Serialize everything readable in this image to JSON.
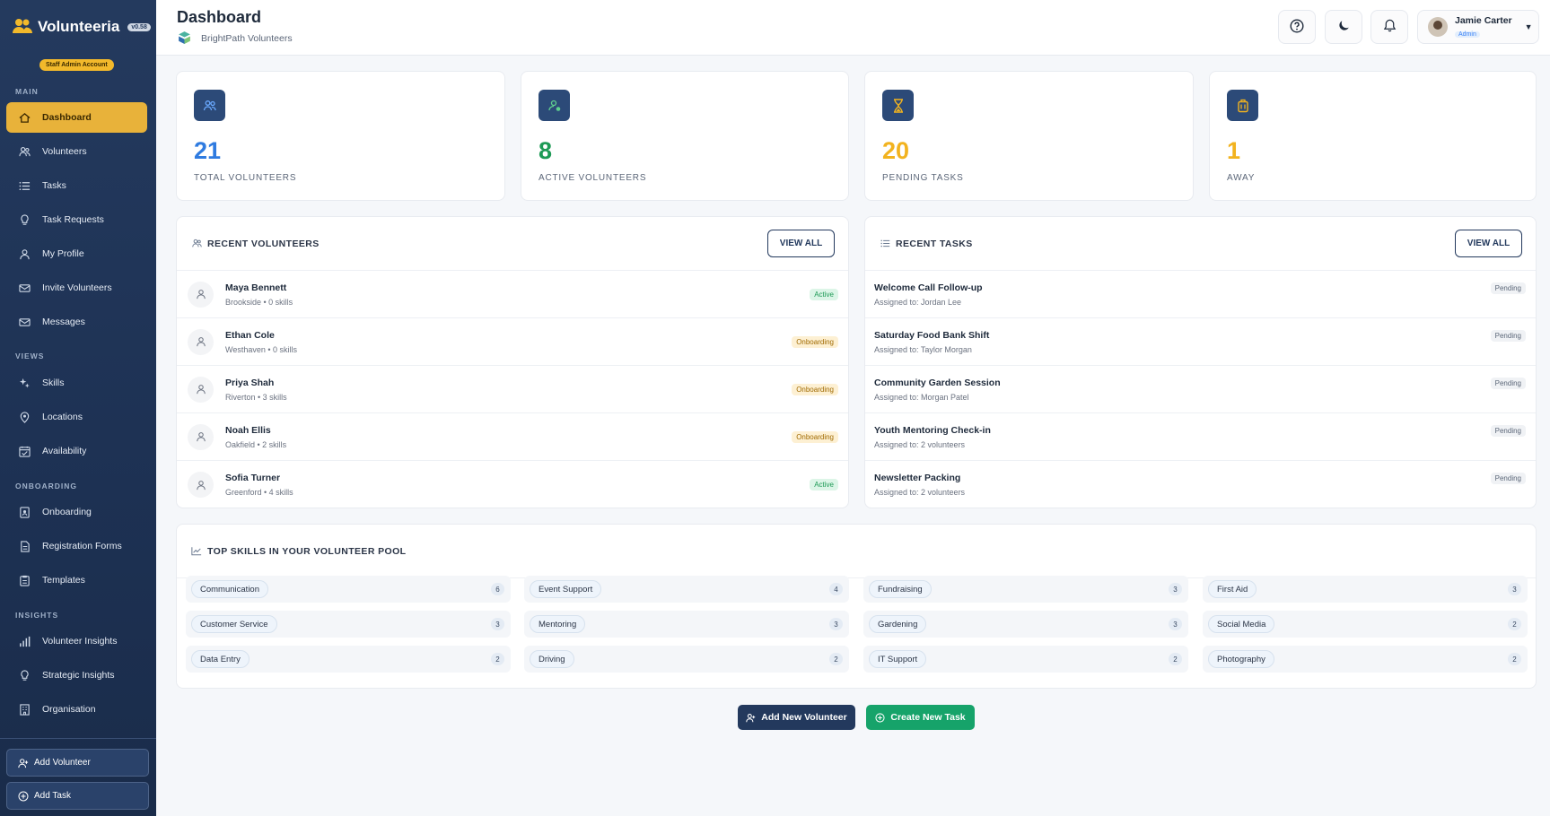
{
  "app": {
    "name": "Volunteeria",
    "version": "v0.58",
    "staff_badge": "Staff Admin Account"
  },
  "colors": {
    "sidebar_bg": "#1d3153",
    "active_nav": "#e8b23a",
    "blue_stat": "#2f7be0",
    "green_stat": "#1d9a55",
    "yellow_stat": "#f2b31f",
    "primary_button": "#23395d",
    "create_button": "#16a36a"
  },
  "sidebar": {
    "sections": [
      {
        "label": "MAIN"
      },
      {
        "label": "VIEWS"
      },
      {
        "label": "ONBOARDING"
      },
      {
        "label": "INSIGHTS"
      }
    ],
    "items": [
      {
        "label": "Dashboard",
        "icon": "home-icon",
        "active": true
      },
      {
        "label": "Volunteers",
        "icon": "users-icon"
      },
      {
        "label": "Tasks",
        "icon": "list-icon"
      },
      {
        "label": "Task Requests",
        "icon": "lightbulb-icon"
      },
      {
        "label": "My Profile",
        "icon": "user-icon"
      },
      {
        "label": "Invite Volunteers",
        "icon": "mail-invite-icon"
      },
      {
        "label": "Messages",
        "icon": "mail-icon"
      },
      {
        "label": "Skills",
        "icon": "sparkle-icon"
      },
      {
        "label": "Locations",
        "icon": "map-pin-icon"
      },
      {
        "label": "Availability",
        "icon": "calendar-icon"
      },
      {
        "label": "Onboarding",
        "icon": "id-badge-icon"
      },
      {
        "label": "Registration Forms",
        "icon": "form-icon"
      },
      {
        "label": "Templates",
        "icon": "clipboard-icon"
      },
      {
        "label": "Volunteer Insights",
        "icon": "bar-chart-icon"
      },
      {
        "label": "Strategic Insights",
        "icon": "lightbulb-icon"
      },
      {
        "label": "Organisation",
        "icon": "building-icon"
      }
    ],
    "add_volunteer": "Add Volunteer",
    "add_task": "Add Task"
  },
  "header": {
    "title": "Dashboard",
    "org_name": "BrightPath Volunteers",
    "user_name": "Jamie Carter",
    "user_role": "Admin"
  },
  "stats": [
    {
      "value": "21",
      "label": "TOTAL VOLUNTEERS",
      "icon": "users-icon"
    },
    {
      "value": "8",
      "label": "ACTIVE VOLUNTEERS",
      "icon": "user-check-icon"
    },
    {
      "value": "20",
      "label": "PENDING TASKS",
      "icon": "hourglass-icon"
    },
    {
      "value": "1",
      "label": "AWAY",
      "icon": "luggage-icon"
    }
  ],
  "recent_volunteers": {
    "title": "RECENT VOLUNTEERS",
    "view_all": "VIEW ALL",
    "rows": [
      {
        "name": "Maya Bennett",
        "sub": "Brookside • 0 skills",
        "status": "Active"
      },
      {
        "name": "Ethan Cole",
        "sub": "Westhaven • 0 skills",
        "status": "Onboarding"
      },
      {
        "name": "Priya Shah",
        "sub": "Riverton • 3 skills",
        "status": "Onboarding"
      },
      {
        "name": "Noah Ellis",
        "sub": "Oakfield • 2 skills",
        "status": "Onboarding"
      },
      {
        "name": "Sofia Turner",
        "sub": "Greenford • 4 skills",
        "status": "Active"
      }
    ]
  },
  "recent_tasks": {
    "title": "RECENT TASKS",
    "view_all": "VIEW ALL",
    "rows": [
      {
        "name": "Welcome Call Follow-up",
        "sub": "Assigned to: Jordan Lee",
        "status": "Pending"
      },
      {
        "name": "Saturday Food Bank Shift",
        "sub": "Assigned to: Taylor Morgan",
        "status": "Pending"
      },
      {
        "name": "Community Garden Session",
        "sub": "Assigned to: Morgan Patel",
        "status": "Pending"
      },
      {
        "name": "Youth Mentoring Check-in",
        "sub": "Assigned to: 2 volunteers",
        "status": "Pending"
      },
      {
        "name": "Newsletter Packing",
        "sub": "Assigned to: 2 volunteers",
        "status": "Pending"
      }
    ]
  },
  "top_skills": {
    "title": "TOP SKILLS IN YOUR VOLUNTEER POOL",
    "items": [
      {
        "name": "Communication",
        "count": "6"
      },
      {
        "name": "Event Support",
        "count": "4"
      },
      {
        "name": "Fundraising",
        "count": "3"
      },
      {
        "name": "First Aid",
        "count": "3"
      },
      {
        "name": "Customer Service",
        "count": "3"
      },
      {
        "name": "Mentoring",
        "count": "3"
      },
      {
        "name": "Gardening",
        "count": "3"
      },
      {
        "name": "Social Media",
        "count": "2"
      },
      {
        "name": "Data Entry",
        "count": "2"
      },
      {
        "name": "Driving",
        "count": "2"
      },
      {
        "name": "IT Support",
        "count": "2"
      },
      {
        "name": "Photography",
        "count": "2"
      }
    ]
  },
  "actions": {
    "add_new_volunteer": "Add New Volunteer",
    "create_new_task": "Create New Task"
  }
}
